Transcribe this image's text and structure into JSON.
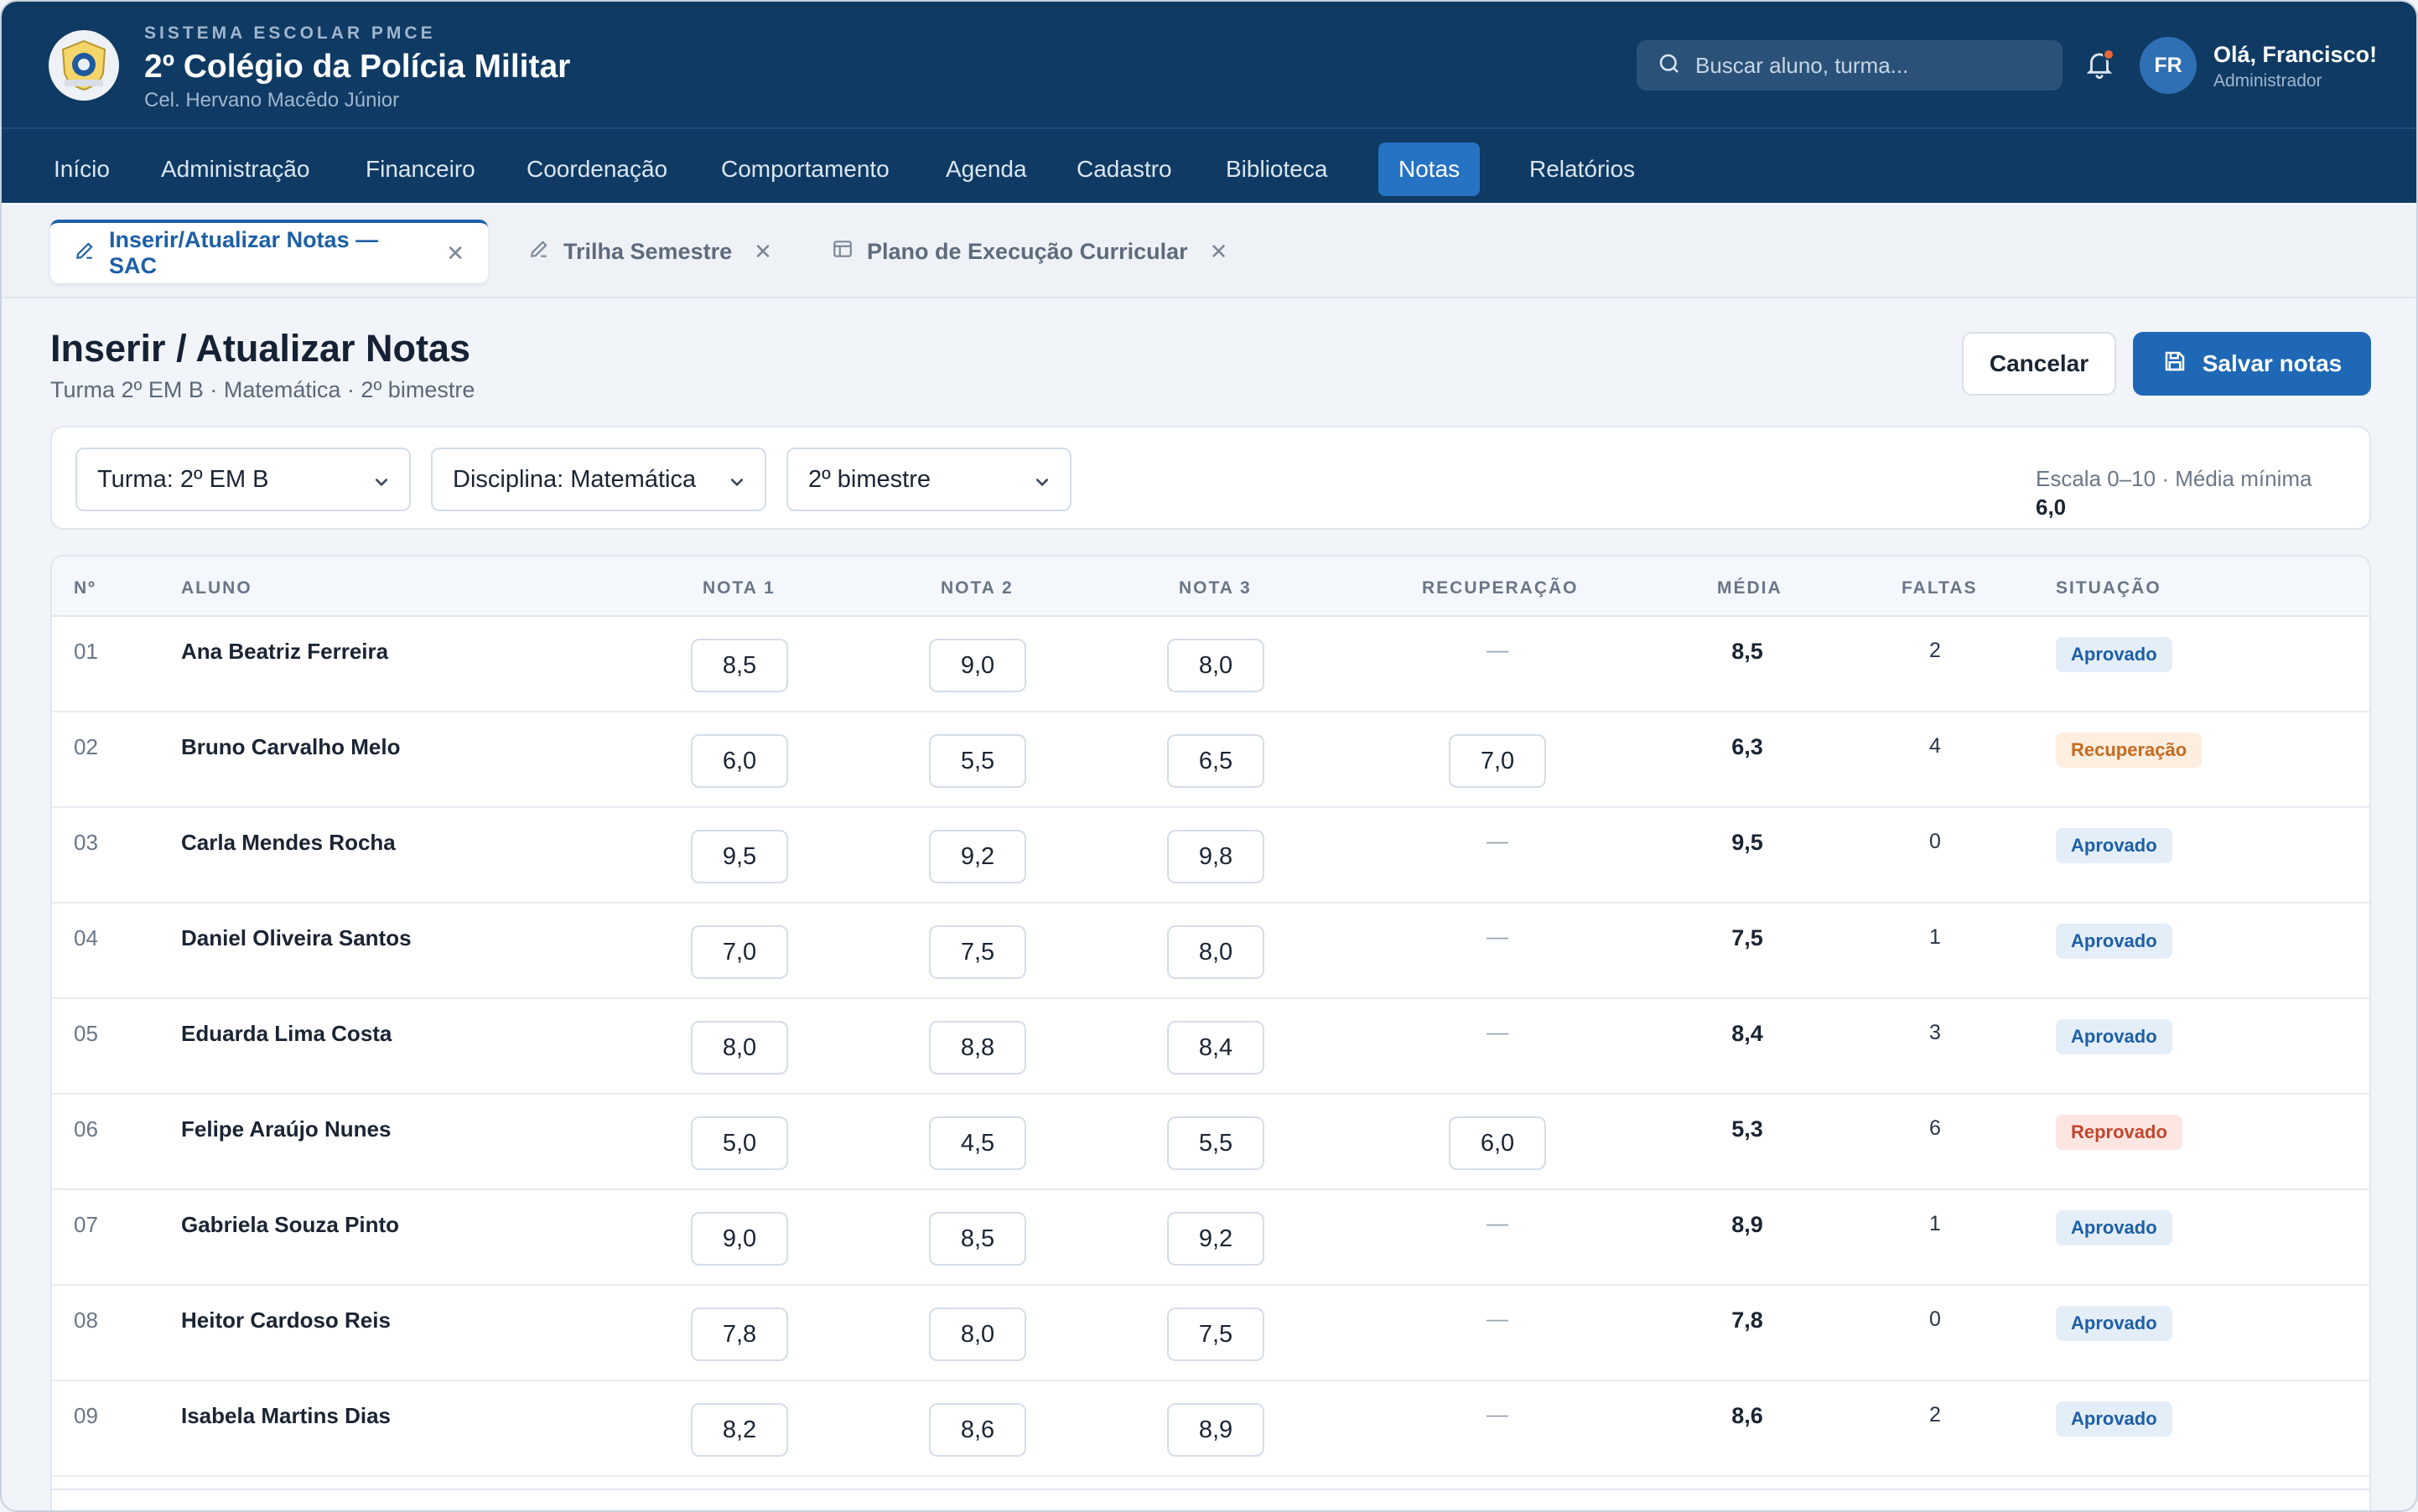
{
  "header": {
    "kicker": "SISTEMA ESCOLAR PMCE",
    "title": "2º Colégio da Polícia Militar",
    "subtitle": "Cel. Hervano Macêdo Júnior",
    "search_placeholder": "Buscar aluno, turma...",
    "avatar_initials": "FR",
    "user_greeting": "Olá, Francisco!",
    "user_role": "Administrador",
    "notification_dot_color": "#e5673a"
  },
  "nav": {
    "items": [
      "Início",
      "Administração",
      "Financeiro",
      "Coordenação",
      "Comportamento",
      "Agenda",
      "Cadastro",
      "Biblioteca",
      "Notas",
      "Relatórios"
    ],
    "active": "Notas"
  },
  "tabs": [
    {
      "label": "Inserir/Atualizar Notas — SAC",
      "icon": "pencil-icon",
      "active": true
    },
    {
      "label": "Trilha Semestre",
      "icon": "pencil-icon",
      "active": false
    },
    {
      "label": "Plano de Execução Curricular",
      "icon": "layout-icon",
      "active": false
    }
  ],
  "page": {
    "title": "Inserir / Atualizar Notas",
    "subtitle": "Turma 2º EM B · Matemática · 2º bimestre",
    "cancel_label": "Cancelar",
    "save_label": "Salvar notas"
  },
  "filters": {
    "turma": "Turma: 2º EM B",
    "disciplina": "Disciplina: Matemática",
    "periodo": "2º bimestre",
    "scale_label": "Escala 0–10 · Média mínima",
    "scale_min": "6,0"
  },
  "table": {
    "columns": [
      "Nº",
      "ALUNO",
      "NOTA 1",
      "NOTA 2",
      "NOTA 3",
      "RECUPERAÇÃO",
      "MÉDIA",
      "FALTAS",
      "SITUAÇÃO"
    ],
    "rows": [
      {
        "num": "01",
        "name": "Ana Beatriz Ferreira",
        "n1": "8,5",
        "n2": "9,0",
        "n3": "8,0",
        "rec": "",
        "avg": "8,5",
        "abs": "2",
        "status": "Aprovado",
        "kind": "ok"
      },
      {
        "num": "02",
        "name": "Bruno Carvalho Melo",
        "n1": "6,0",
        "n2": "5,5",
        "n3": "6,5",
        "rec": "7,0",
        "avg": "6,3",
        "abs": "4",
        "status": "Recuperação",
        "kind": "rec"
      },
      {
        "num": "03",
        "name": "Carla Mendes Rocha",
        "n1": "9,5",
        "n2": "9,2",
        "n3": "9,8",
        "rec": "",
        "avg": "9,5",
        "abs": "0",
        "status": "Aprovado",
        "kind": "ok"
      },
      {
        "num": "04",
        "name": "Daniel Oliveira Santos",
        "n1": "7,0",
        "n2": "7,5",
        "n3": "8,0",
        "rec": "",
        "avg": "7,5",
        "abs": "1",
        "status": "Aprovado",
        "kind": "ok"
      },
      {
        "num": "05",
        "name": "Eduarda Lima Costa",
        "n1": "8,0",
        "n2": "8,8",
        "n3": "8,4",
        "rec": "",
        "avg": "8,4",
        "abs": "3",
        "status": "Aprovado",
        "kind": "ok"
      },
      {
        "num": "06",
        "name": "Felipe Araújo Nunes",
        "n1": "5,0",
        "n2": "4,5",
        "n3": "5,5",
        "rec": "6,0",
        "avg": "5,3",
        "abs": "6",
        "status": "Reprovado",
        "kind": "rep"
      },
      {
        "num": "07",
        "name": "Gabriela Souza Pinto",
        "n1": "9,0",
        "n2": "8,5",
        "n3": "9,2",
        "rec": "",
        "avg": "8,9",
        "abs": "1",
        "status": "Aprovado",
        "kind": "ok"
      },
      {
        "num": "08",
        "name": "Heitor Cardoso Reis",
        "n1": "7,8",
        "n2": "8,0",
        "n3": "7,5",
        "rec": "",
        "avg": "7,8",
        "abs": "0",
        "status": "Aprovado",
        "kind": "ok"
      },
      {
        "num": "09",
        "name": "Isabela Martins Dias",
        "n1": "8,2",
        "n2": "8,6",
        "n3": "8,9",
        "rec": "",
        "avg": "8,6",
        "abs": "2",
        "status": "Aprovado",
        "kind": "ok"
      }
    ],
    "empty_recovery": "—"
  },
  "colors": {
    "header_bg": "#0f3a63",
    "accent": "#1e68b6",
    "approved": "#1d5fa6",
    "recovery": "#c56a1f",
    "failed": "#c2462d"
  }
}
